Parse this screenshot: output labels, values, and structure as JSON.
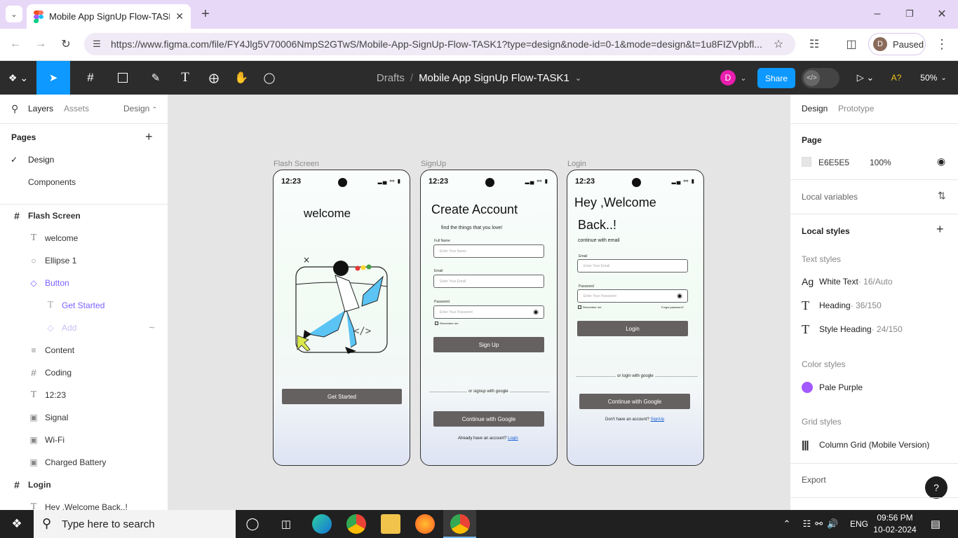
{
  "browser": {
    "tab_title": "Mobile App SignUp Flow-TASK1",
    "url": "https://www.figma.com/file/FY4Jlg5V70006NmpS2GTwS/Mobile-App-SignUp-Flow-TASK1?type=design&node-id=0-1&mode=design&t=1u8FIZVpbfl...",
    "profile_letter": "D",
    "profile_status": "Paused"
  },
  "toolbar": {
    "breadcrumb_root": "Drafts",
    "file_name": "Mobile App SignUp Flow-TASK1",
    "user_initial": "D",
    "share_label": "Share",
    "a11y_label": "A?",
    "zoom": "50%"
  },
  "left_panel": {
    "tabs": [
      "Layers",
      "Assets"
    ],
    "page_dropdown": "Design",
    "pages_label": "Pages",
    "pages": [
      "Design",
      "Components"
    ],
    "layers": [
      {
        "name": "Flash Screen",
        "icon": "frame-icon"
      },
      {
        "name": "welcome",
        "icon": "text-icon"
      },
      {
        "name": "Ellipse 1",
        "icon": "ellipse-icon"
      },
      {
        "name": "Button",
        "icon": "component-icon"
      },
      {
        "name": "Get Started",
        "icon": "text-icon"
      },
      {
        "name": "Add",
        "icon": "component-icon"
      },
      {
        "name": "Content",
        "icon": "auto-layout-icon"
      },
      {
        "name": "Coding",
        "icon": "frame-icon"
      },
      {
        "name": "12:23",
        "icon": "text-icon"
      },
      {
        "name": "Signal",
        "icon": "image-icon"
      },
      {
        "name": "Wi-Fi",
        "icon": "image-icon"
      },
      {
        "name": "Charged Battery",
        "icon": "image-icon"
      },
      {
        "name": "Login",
        "icon": "frame-icon"
      },
      {
        "name": "Hey ,Welcome Back..!",
        "icon": "text-icon"
      }
    ]
  },
  "right_panel": {
    "tabs": [
      "Design",
      "Prototype"
    ],
    "page_label": "Page",
    "page_color": "E6E5E5",
    "page_opacity": "100%",
    "local_variables": "Local variables",
    "local_styles": "Local styles",
    "text_styles_label": "Text styles",
    "text_styles": [
      {
        "name": "White Text",
        "meta": " · 16/Auto",
        "icon": "Ag"
      },
      {
        "name": "Heading",
        "meta": " · 36/150",
        "icon": "T"
      },
      {
        "name": "Style Heading",
        "meta": " · 24/150",
        "icon": "T"
      }
    ],
    "color_styles_label": "Color styles",
    "color_style": {
      "name": "Pale Purple",
      "color": "#a259ff"
    },
    "grid_styles_label": "Grid styles",
    "grid_style": "Column Grid (Mobile Version)",
    "export_label": "Export",
    "help": "?"
  },
  "canvas": {
    "flash": {
      "label": "Flash Screen",
      "time": "12:23",
      "title": "welcome",
      "button": "Get Started"
    },
    "signup": {
      "label": "SignUp",
      "time": "12:23",
      "title": "Create Account",
      "subtitle": "find the things that you  love!",
      "full_name_label": "Full Name",
      "full_name_placeholder": "Enter Your Name",
      "email_label": "Email",
      "email_placeholder": "Enter Your Email",
      "password_label": "Password",
      "password_placeholder": "Enter Your Password",
      "remember": "Remember me",
      "button": "Sign Up",
      "divider": "or signup with google",
      "google_button": "Continue with Google",
      "have_account": "Already have an account? ",
      "login_link": "Login"
    },
    "login": {
      "label": "Login",
      "time": "12:23",
      "title_1": "Hey ,Welcome",
      "title_2": "Back..!",
      "subtitle": "continue with email",
      "email_label": "Email",
      "email_placeholder": "Enter Your Email",
      "password_label": "Password",
      "password_placeholder": "Enter Your Password",
      "remember": "Remember me",
      "forgot": "Forgot password?",
      "button": "Login",
      "divider": "or login with google",
      "google_button": "Continue with Google",
      "no_account": "Don't have an account? ",
      "signup_link": "SignUp"
    }
  },
  "taskbar": {
    "search_placeholder": "Type here to search",
    "language": "ENG",
    "time": "09:56 PM",
    "date": "10-02-2024"
  }
}
